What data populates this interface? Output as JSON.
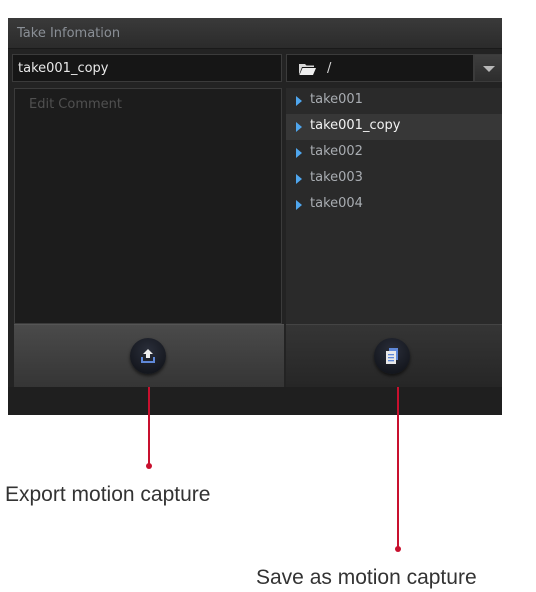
{
  "panel": {
    "title": "Take Infomation",
    "take_name": "take001_copy",
    "path": "/",
    "comment_placeholder": "Edit Comment",
    "takes": [
      {
        "label": "take001",
        "selected": false
      },
      {
        "label": "take001_copy",
        "selected": true
      },
      {
        "label": "take002",
        "selected": false
      },
      {
        "label": "take003",
        "selected": false
      },
      {
        "label": "take004",
        "selected": false
      }
    ],
    "export_icon": "upload-tray-icon",
    "save_icon": "document-stack-icon"
  },
  "callouts": {
    "export": "Export motion capture",
    "save_as": "Save as motion capture"
  },
  "colors": {
    "accent": "#c8102e",
    "tree_arrow": "#4fa6ee",
    "icon_blue": "#5f88d8"
  }
}
